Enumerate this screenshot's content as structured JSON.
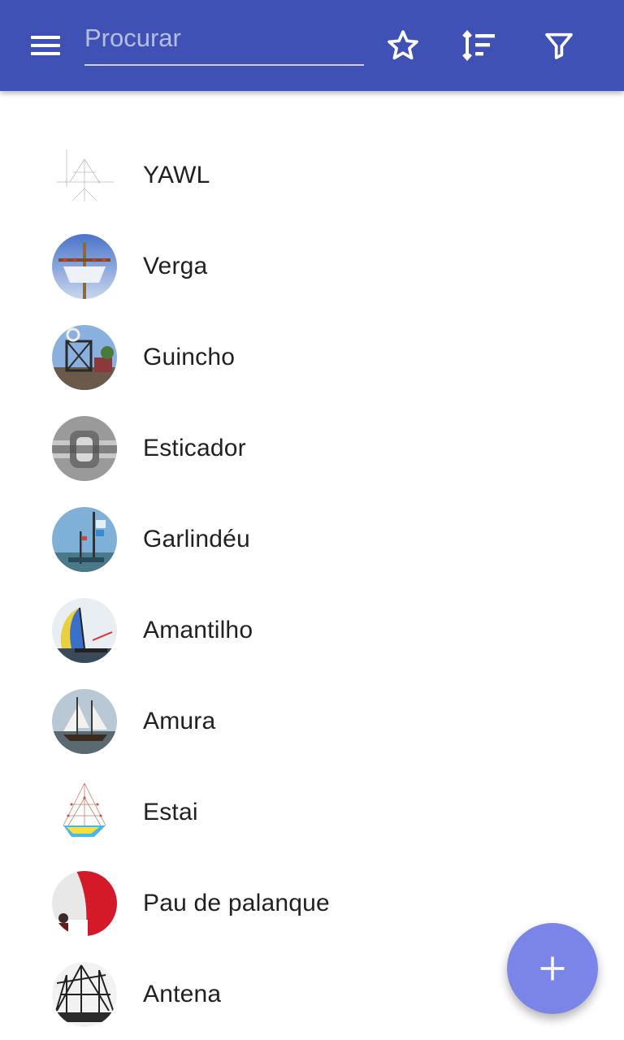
{
  "app_bar": {
    "background": "#3f51b5",
    "menu_icon": "menu-icon",
    "search": {
      "placeholder": "Procurar",
      "value": ""
    },
    "actions": [
      "star-icon",
      "sort-icon",
      "filter-icon"
    ]
  },
  "items": [
    {
      "label": "YAWL",
      "thumb": "sail-diagram"
    },
    {
      "label": "Verga",
      "thumb": "mast-yard-photo"
    },
    {
      "label": "Guincho",
      "thumb": "winch-photo"
    },
    {
      "label": "Esticador",
      "thumb": "turnbuckle-photo"
    },
    {
      "label": "Garlindéu",
      "thumb": "flag-mast-photo"
    },
    {
      "label": "Amantilho",
      "thumb": "spinnaker-photo"
    },
    {
      "label": "Amura",
      "thumb": "schooner-photo"
    },
    {
      "label": "Estai",
      "thumb": "rigging-diagram"
    },
    {
      "label": "Pau de palanque",
      "thumb": "red-sail-photo"
    },
    {
      "label": "Antena",
      "thumb": "galleon-photo"
    }
  ],
  "fab": {
    "icon": "plus-icon",
    "color": "#7986e8"
  }
}
